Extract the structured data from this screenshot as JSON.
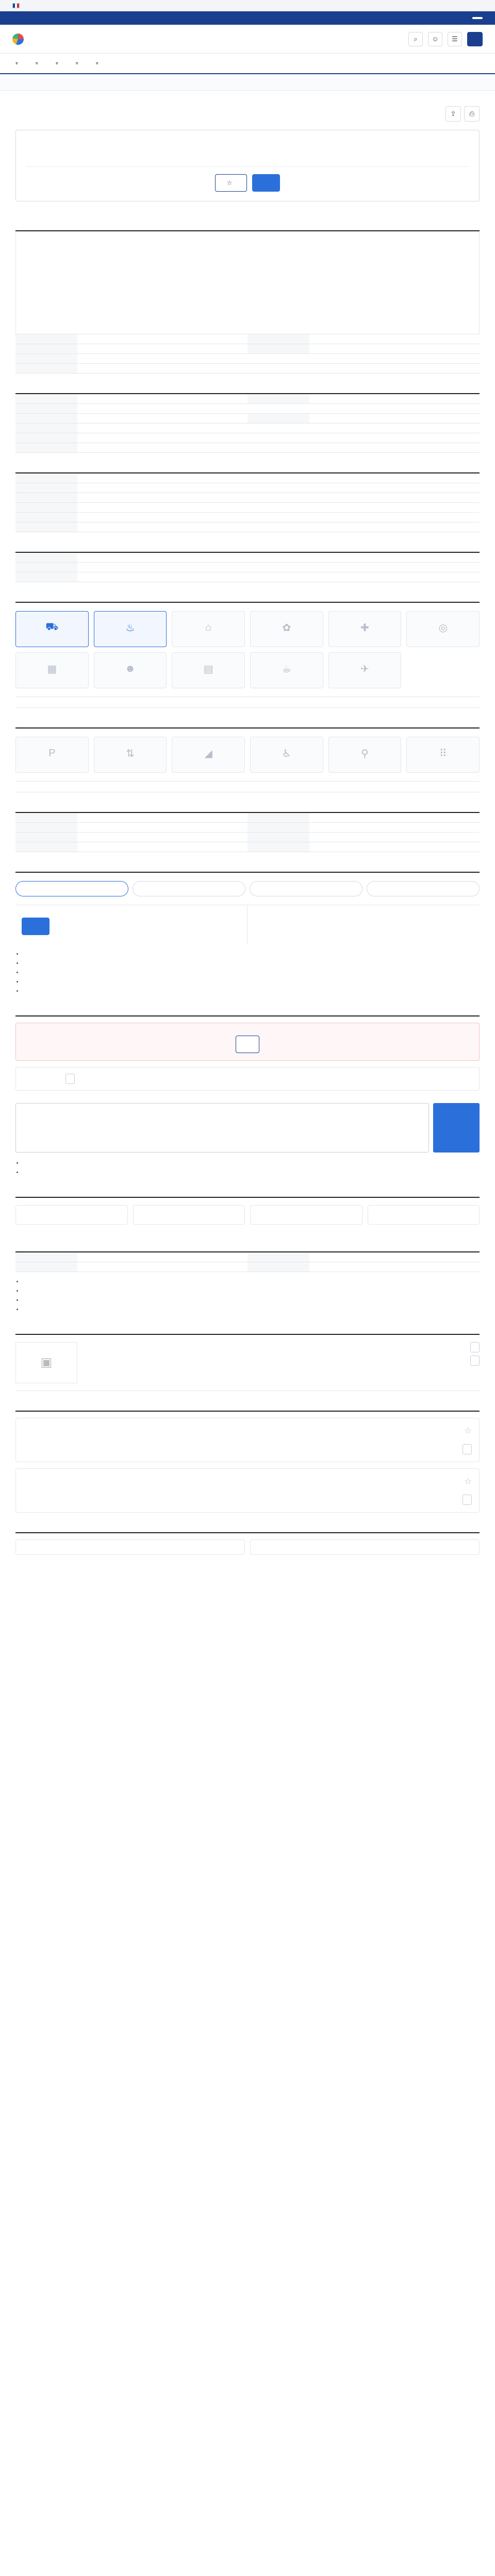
{
  "gov_strip": {
    "text": ""
  },
  "top_banner": {
    "text": "",
    "button": ""
  },
  "header": {
    "logo": "",
    "login": ""
  },
  "nav": {
    "items": [
      "",
      "",
      "",
      "",
      "",
      ""
    ]
  },
  "sub_nav": {
    "items": [
      "",
      "",
      "",
      "",
      "",
      ""
    ]
  },
  "job": {
    "company": "",
    "title": "",
    "summary": {
      "left_title": "",
      "left": [
        {
          "k": "",
          "v": ""
        },
        {
          "k": "",
          "v": ""
        },
        {
          "k": "",
          "v": ""
        }
      ],
      "right_title": "",
      "right": [
        {
          "k": "",
          "v": ""
        },
        {
          "k": "",
          "v": ""
        },
        {
          "k": "",
          "v": ""
        }
      ],
      "left2_title": "",
      "left2": [
        {
          "k": "",
          "v": ""
        },
        {
          "k": "",
          "v": ""
        }
      ],
      "btn_scrap": "",
      "btn_apply": "",
      "note": ""
    }
  },
  "sections": {
    "recruit": {
      "title": "",
      "desc_head": "",
      "desc_lines": [
        "",
        "",
        "",
        "",
        "",
        "",
        "",
        "",
        ""
      ],
      "rows": [
        {
          "k": "",
          "v": ""
        },
        {
          "k": "",
          "v": ""
        },
        {
          "k": "",
          "v": ""
        },
        {
          "k": "",
          "v": ""
        },
        {
          "k": "",
          "v": ""
        },
        {
          "k": "",
          "v": ""
        }
      ]
    },
    "conditions": {
      "title": "",
      "rows": [
        {
          "k": "",
          "v": ""
        },
        {
          "k": "",
          "v": ""
        },
        {
          "k": "",
          "v": ""
        },
        {
          "k": "",
          "v": ""
        },
        {
          "k": "",
          "v": ""
        },
        {
          "k": "",
          "v": ""
        },
        {
          "k": "",
          "v": ""
        },
        {
          "k": "",
          "v": ""
        }
      ],
      "footnote": ""
    },
    "prefer": {
      "title": "",
      "rows": [
        {
          "k": "",
          "v": ""
        },
        {
          "k": "",
          "v": ""
        },
        {
          "k": "",
          "v": ""
        },
        {
          "k": "",
          "v": ""
        },
        {
          "k": "",
          "v": ""
        },
        {
          "k": "",
          "v": ""
        }
      ]
    },
    "other": {
      "title": "",
      "rows": [
        {
          "k": "",
          "v": ""
        },
        {
          "k": "",
          "v": ""
        },
        {
          "k": "",
          "v": ""
        }
      ]
    },
    "welfare": {
      "title": "",
      "cards": [
        "",
        "",
        "",
        "",
        "",
        "",
        "",
        "",
        "",
        "",
        ""
      ],
      "note": ""
    },
    "disability": {
      "title": "",
      "cards": [
        "",
        "",
        "",
        "",
        "",
        ""
      ],
      "note": ""
    },
    "work_env": {
      "title": "",
      "rows": [
        {
          "k1": "",
          "v1": "",
          "k2": "",
          "v2": ""
        },
        {
          "k1": "",
          "v1": "",
          "k2": "",
          "v2": ""
        },
        {
          "k1": "",
          "v1": "",
          "k2": "",
          "v2": ""
        },
        {
          "k1": "",
          "v1": "",
          "k2": "",
          "v2": ""
        }
      ]
    },
    "selection": {
      "title": "",
      "steps": [
        "",
        "",
        "",
        ""
      ],
      "col1_label": "",
      "col1_value": "",
      "col2_label": "",
      "col2_value": "",
      "apply_btn": "",
      "bullets": [
        "",
        "",
        "",
        "",
        ""
      ]
    },
    "contact": {
      "title": "",
      "alert_title": "",
      "alert_text": "",
      "alert_btn": "",
      "name_k": "",
      "name_v": "",
      "phone_k": "",
      "phone_v": "",
      "phone_btn": "",
      "inquiry_title": "",
      "inquiry_placeholder": "",
      "counter": "",
      "send": "",
      "bullets": [
        "",
        ""
      ]
    },
    "stats": {
      "title": "",
      "items": [
        {
          "label": "",
          "value": ""
        },
        {
          "label": "",
          "value": ""
        },
        {
          "label": "",
          "value": ""
        },
        {
          "label": "",
          "value": ""
        }
      ],
      "note": ""
    },
    "info": {
      "title": "",
      "rows": [
        {
          "k1": "",
          "v1": "",
          "k2": "",
          "v2": ""
        },
        {
          "k1": "",
          "v1": "",
          "k2": "",
          "v2": ""
        }
      ],
      "bullets": [
        "",
        "",
        "",
        ""
      ]
    },
    "company": {
      "title": "",
      "fields": [
        {
          "k": "",
          "v": ""
        },
        {
          "k": "",
          "v": ""
        },
        {
          "k": "",
          "v": ""
        },
        {
          "k": "",
          "v": ""
        },
        {
          "k": "",
          "v": ""
        },
        {
          "k": "",
          "v": ""
        },
        {
          "k": "",
          "v": ""
        },
        {
          "k": "",
          "v": ""
        }
      ],
      "btn1": "",
      "btn2": ""
    },
    "related": {
      "title": "",
      "jobs": [
        {
          "company": "",
          "title": "",
          "m1": "",
          "m2": "",
          "m3": "",
          "m4": "",
          "dday": "",
          "btn": ""
        },
        {
          "company": "",
          "title": "",
          "m1": "",
          "m2": "",
          "m3": "",
          "m4": "",
          "dday": "",
          "btn": ""
        }
      ]
    },
    "recommend": {
      "title": "",
      "cards": [
        {
          "company": "",
          "title": "",
          "meta": ""
        },
        {
          "company": "",
          "title": "",
          "meta": ""
        }
      ]
    }
  }
}
